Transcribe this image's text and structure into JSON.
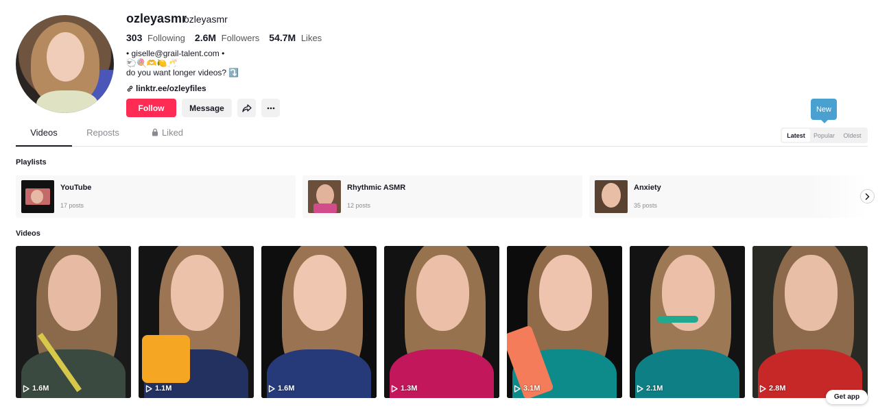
{
  "profile": {
    "username": "ozleyasmr",
    "nickname": "ozleyasmr",
    "stats": [
      {
        "value": "303",
        "label": "Following"
      },
      {
        "value": "2.6M",
        "label": "Followers"
      },
      {
        "value": "54.7M",
        "label": "Likes"
      }
    ],
    "bio": [
      "• giselle@grail-talent.com •",
      "🐑🍭🫶🍋🥂",
      "do you want longer videos? ⤵️"
    ],
    "link": "linktr.ee/ozleyfiles"
  },
  "actions": {
    "follow": "Follow",
    "message": "Message"
  },
  "tabs": [
    "Videos",
    "Reposts",
    "Liked"
  ],
  "new_tip": "New",
  "sort": [
    "Latest",
    "Popular",
    "Oldest"
  ],
  "sections": {
    "playlists": "Playlists",
    "videos": "Videos"
  },
  "playlists": [
    {
      "name": "YouTube",
      "count": "17 posts"
    },
    {
      "name": "Rhythmic ASMR",
      "count": "12 posts"
    },
    {
      "name": "Anxiety",
      "count": "35 posts"
    }
  ],
  "videos": [
    {
      "views": "1.6M",
      "color": "#1f2a22"
    },
    {
      "views": "1.1M",
      "color": "#1a2440"
    },
    {
      "views": "1.6M",
      "color": "#1b2750"
    },
    {
      "views": "1.3M",
      "color": "#c2185b"
    },
    {
      "views": "3.1M",
      "color": "#0d8a8a"
    },
    {
      "views": "2.1M",
      "color": "#0e7f84"
    },
    {
      "views": "2.8M",
      "color": "#c62828"
    }
  ],
  "get_app": "Get app",
  "colors": {
    "accent": "#fe2c55",
    "tooltip": "#4aa0cf"
  }
}
